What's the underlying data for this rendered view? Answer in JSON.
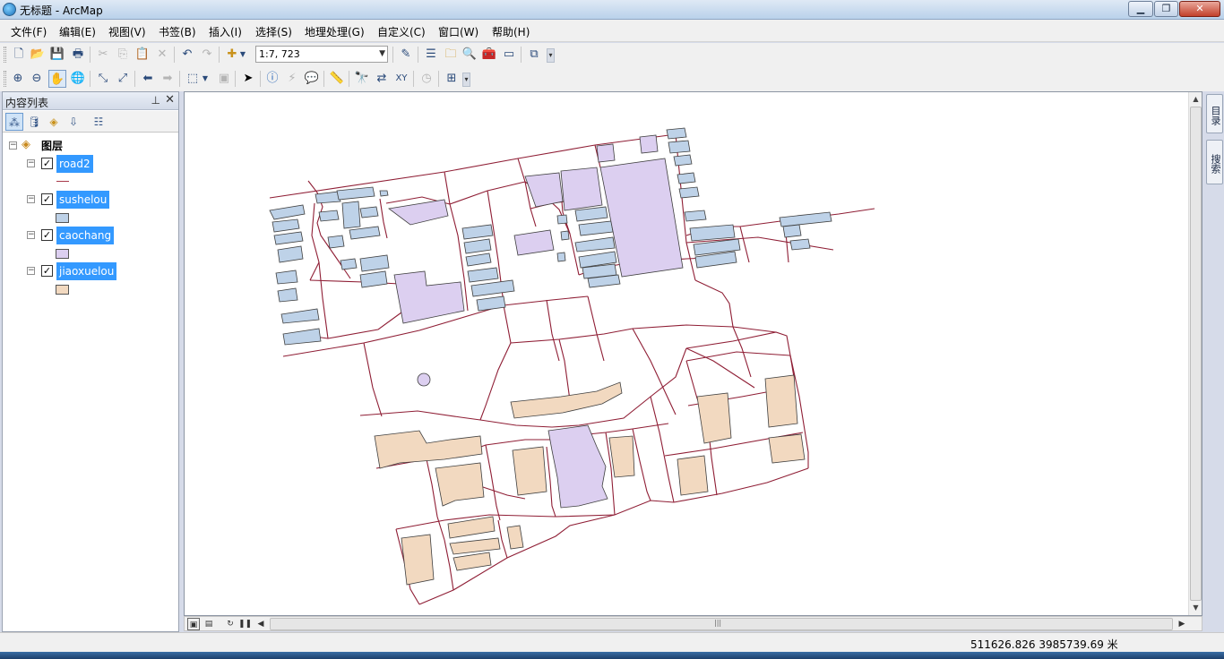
{
  "window": {
    "title": "无标题 - ArcMap"
  },
  "menu": [
    "文件(F)",
    "编辑(E)",
    "视图(V)",
    "书签(B)",
    "插入(I)",
    "选择(S)",
    "地理处理(G)",
    "自定义(C)",
    "窗口(W)",
    "帮助(H)"
  ],
  "toolbar": {
    "scale": "1:7, 723"
  },
  "toc": {
    "title": "内容列表",
    "group": "图层",
    "layers": [
      {
        "name": "road2",
        "visible": true,
        "symbol": "line",
        "color": "#a8394b"
      },
      {
        "name": "sushelou",
        "visible": true,
        "symbol": "fill",
        "color": "#bed2e8"
      },
      {
        "name": "caochang",
        "visible": true,
        "symbol": "fill",
        "color": "#dccff0"
      },
      {
        "name": "jiaoxuelou",
        "visible": true,
        "symbol": "fill",
        "color": "#f2d9c0"
      }
    ]
  },
  "dock": {
    "catalog": "目录",
    "search": "搜索"
  },
  "status": {
    "coords": "511626.826  3985739.69 米"
  },
  "colors": {
    "road": "#8f1e35",
    "sushelou": "#bed2e8",
    "caochang": "#dccff0",
    "jiaoxuelou": "#f2d9c0",
    "outline": "#3f3f3f"
  }
}
